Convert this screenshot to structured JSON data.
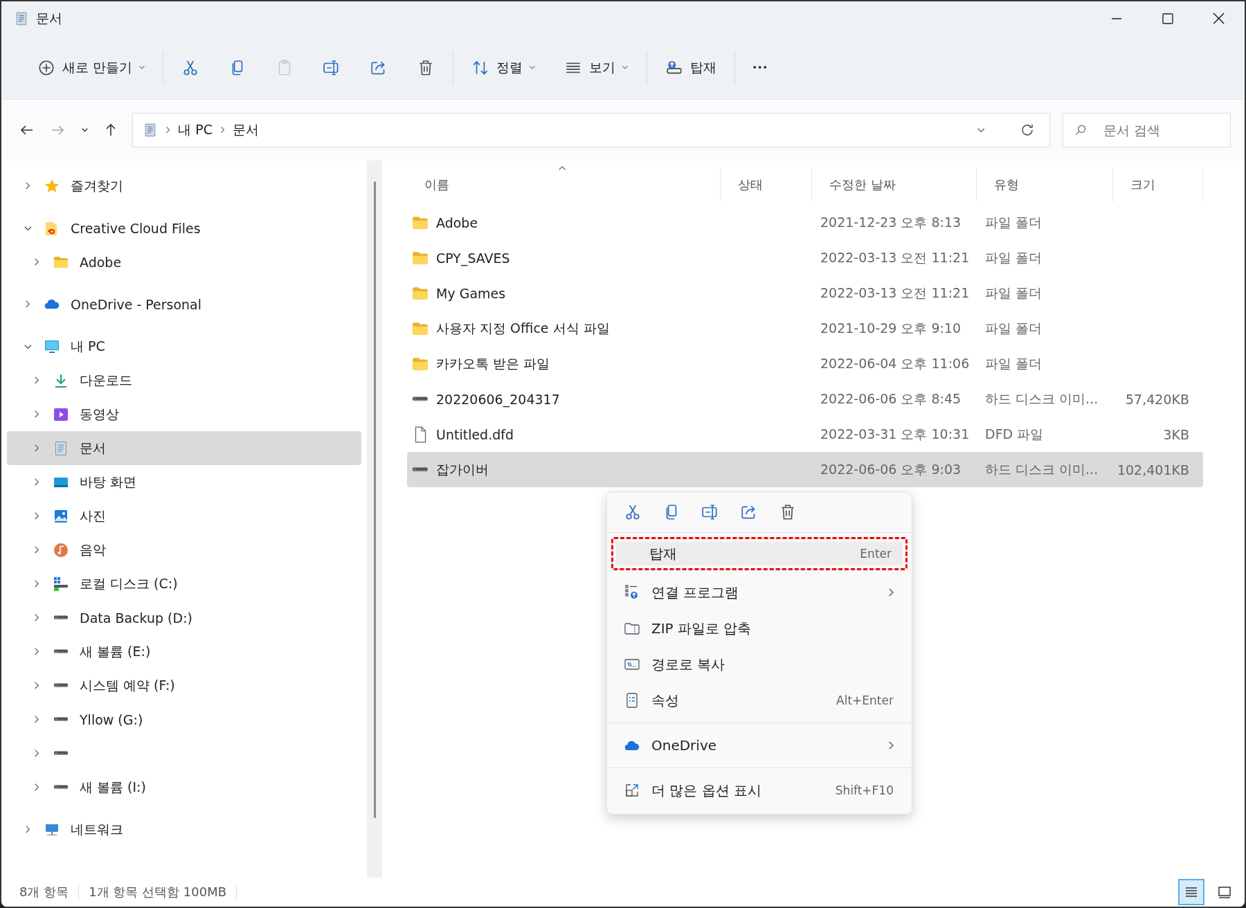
{
  "window": {
    "title": "문서"
  },
  "toolbar": {
    "groups": [
      {
        "buttons": [
          {
            "kind": "new",
            "label": "새로 만들기",
            "dropdown": true,
            "disabled": false
          }
        ]
      },
      {
        "buttons": [
          {
            "kind": "cut",
            "disabled": false
          },
          {
            "kind": "copy",
            "disabled": false
          },
          {
            "kind": "paste",
            "disabled": true
          },
          {
            "kind": "rename",
            "disabled": false
          },
          {
            "kind": "share",
            "disabled": false
          },
          {
            "kind": "delete",
            "disabled": false
          }
        ]
      },
      {
        "buttons": [
          {
            "kind": "sort",
            "label": "정렬",
            "dropdown": true,
            "disabled": false
          },
          {
            "kind": "view",
            "label": "보기",
            "dropdown": true,
            "disabled": false
          }
        ]
      },
      {
        "buttons": [
          {
            "kind": "mount",
            "label": "탑재",
            "dropdown": false,
            "disabled": false
          }
        ]
      },
      {
        "buttons": [
          {
            "kind": "more",
            "disabled": false
          }
        ]
      }
    ]
  },
  "nav_buttons": [
    {
      "kind": "back",
      "disabled": false
    },
    {
      "kind": "forward",
      "disabled": true
    },
    {
      "kind": "recent",
      "disabled": false
    },
    {
      "kind": "up",
      "disabled": false
    }
  ],
  "address": {
    "path": [
      "내 PC",
      "문서"
    ]
  },
  "search": {
    "placeholder": "문서 검색"
  },
  "sidebar": {
    "items": [
      {
        "label": "즐겨찾기",
        "kind": "favorites",
        "expanded": false,
        "selected": false
      },
      {
        "label": "Creative Cloud Files",
        "kind": "cloud_files",
        "expanded": true,
        "selected": false,
        "children": [
          {
            "label": "Adobe",
            "kind": "folder",
            "expanded": false,
            "selected": false
          }
        ]
      },
      {
        "label": "OneDrive - Personal",
        "kind": "cloud",
        "expanded": false,
        "selected": false
      },
      {
        "label": "내 PC",
        "kind": "pc",
        "expanded": true,
        "selected": false,
        "children": [
          {
            "label": "다운로드",
            "kind": "downloads",
            "expanded": false,
            "selected": false
          },
          {
            "label": "동영상",
            "kind": "videos",
            "expanded": false,
            "selected": false
          },
          {
            "label": "문서",
            "kind": "documents",
            "expanded": false,
            "selected": true
          },
          {
            "label": "바탕 화면",
            "kind": "desktop",
            "expanded": false,
            "selected": false
          },
          {
            "label": "사진",
            "kind": "pictures",
            "expanded": false,
            "selected": false
          },
          {
            "label": "음악",
            "kind": "music",
            "expanded": false,
            "selected": false
          },
          {
            "label": "로컬 디스크 (C:)",
            "kind": "system_drive",
            "expanded": false,
            "selected": false
          },
          {
            "label": "Data Backup (D:)",
            "kind": "drive",
            "expanded": false,
            "selected": false
          },
          {
            "label": "새 볼륨 (E:)",
            "kind": "drive",
            "expanded": false,
            "selected": false
          },
          {
            "label": "시스템 예약 (F:)",
            "kind": "drive",
            "expanded": false,
            "selected": false
          },
          {
            "label": "Yllow (G:)",
            "kind": "drive",
            "expanded": false,
            "selected": false
          },
          {
            "kind": "drive",
            "expanded": false,
            "selected": false
          },
          {
            "label": "새 볼륨 (I:)",
            "kind": "drive",
            "expanded": false,
            "selected": false
          }
        ]
      },
      {
        "label": "네트워크",
        "kind": "network",
        "expanded": false,
        "selected": false
      }
    ]
  },
  "file_list": {
    "columns": [
      {
        "label": "이름",
        "sorted": true
      },
      {
        "label": "상태"
      },
      {
        "label": "수정한 날짜"
      },
      {
        "label": "유형"
      },
      {
        "label": "크기"
      }
    ],
    "rows": [
      {
        "name": "Adobe",
        "kind": "folder",
        "date": "2021-12-23 오후 8:13",
        "type": "파일 폴더",
        "selected": false
      },
      {
        "name": "CPY_SAVES",
        "kind": "folder",
        "date": "2022-03-13 오전 11:21",
        "type": "파일 폴더",
        "selected": false
      },
      {
        "name": "My Games",
        "kind": "folder",
        "date": "2022-03-13 오전 11:21",
        "type": "파일 폴더",
        "selected": false
      },
      {
        "name": "사용자 지정 Office 서식 파일",
        "kind": "folder",
        "date": "2021-10-29 오후 9:10",
        "type": "파일 폴더",
        "selected": false
      },
      {
        "name": "카카오톡 받은 파일",
        "kind": "folder",
        "date": "2022-06-04 오후 11:06",
        "type": "파일 폴더",
        "selected": false
      },
      {
        "name": "20220606_204317",
        "kind": "disk_image",
        "date": "2022-06-06 오후 8:45",
        "type": "하드 디스크 이미...",
        "size": "57,420KB",
        "selected": false
      },
      {
        "name": "Untitled.dfd",
        "kind": "file",
        "date": "2022-03-31 오후 10:31",
        "type": "DFD 파일",
        "size": "3KB",
        "selected": false
      },
      {
        "name": "잡가이버",
        "kind": "disk_image",
        "date": "2022-06-06 오후 9:03",
        "type": "하드 디스크 이미...",
        "size": "102,401KB",
        "selected": true
      }
    ]
  },
  "context_menu": {
    "quick_actions": [
      {
        "kind": "cut"
      },
      {
        "kind": "copy"
      },
      {
        "kind": "rename"
      },
      {
        "kind": "share"
      },
      {
        "kind": "delete"
      }
    ],
    "items": [
      {
        "kind": "item",
        "label": "탑재",
        "shortcut": "Enter",
        "highlighted": true
      },
      {
        "kind": "item",
        "label": "연결 프로그램",
        "submenu": true,
        "highlighted": false
      },
      {
        "kind": "item",
        "label": "ZIP 파일로 압축",
        "highlighted": false
      },
      {
        "kind": "item",
        "label": "경로로 복사",
        "highlighted": false
      },
      {
        "kind": "item",
        "label": "속성",
        "shortcut": "Alt+Enter",
        "highlighted": false
      },
      {
        "kind": "separator"
      },
      {
        "kind": "item",
        "label": "OneDrive",
        "submenu": true,
        "highlighted": false
      },
      {
        "kind": "separator"
      },
      {
        "kind": "item",
        "label": "더 많은 옵션 표시",
        "shortcut": "Shift+F10",
        "highlighted": false
      }
    ]
  },
  "status_bar": {
    "item_count": "8개 항목",
    "selection": "1개 항목 선택함 100MB",
    "views": [
      {
        "kind": "details",
        "selected": true
      },
      {
        "kind": "tiles",
        "selected": false
      }
    ]
  }
}
